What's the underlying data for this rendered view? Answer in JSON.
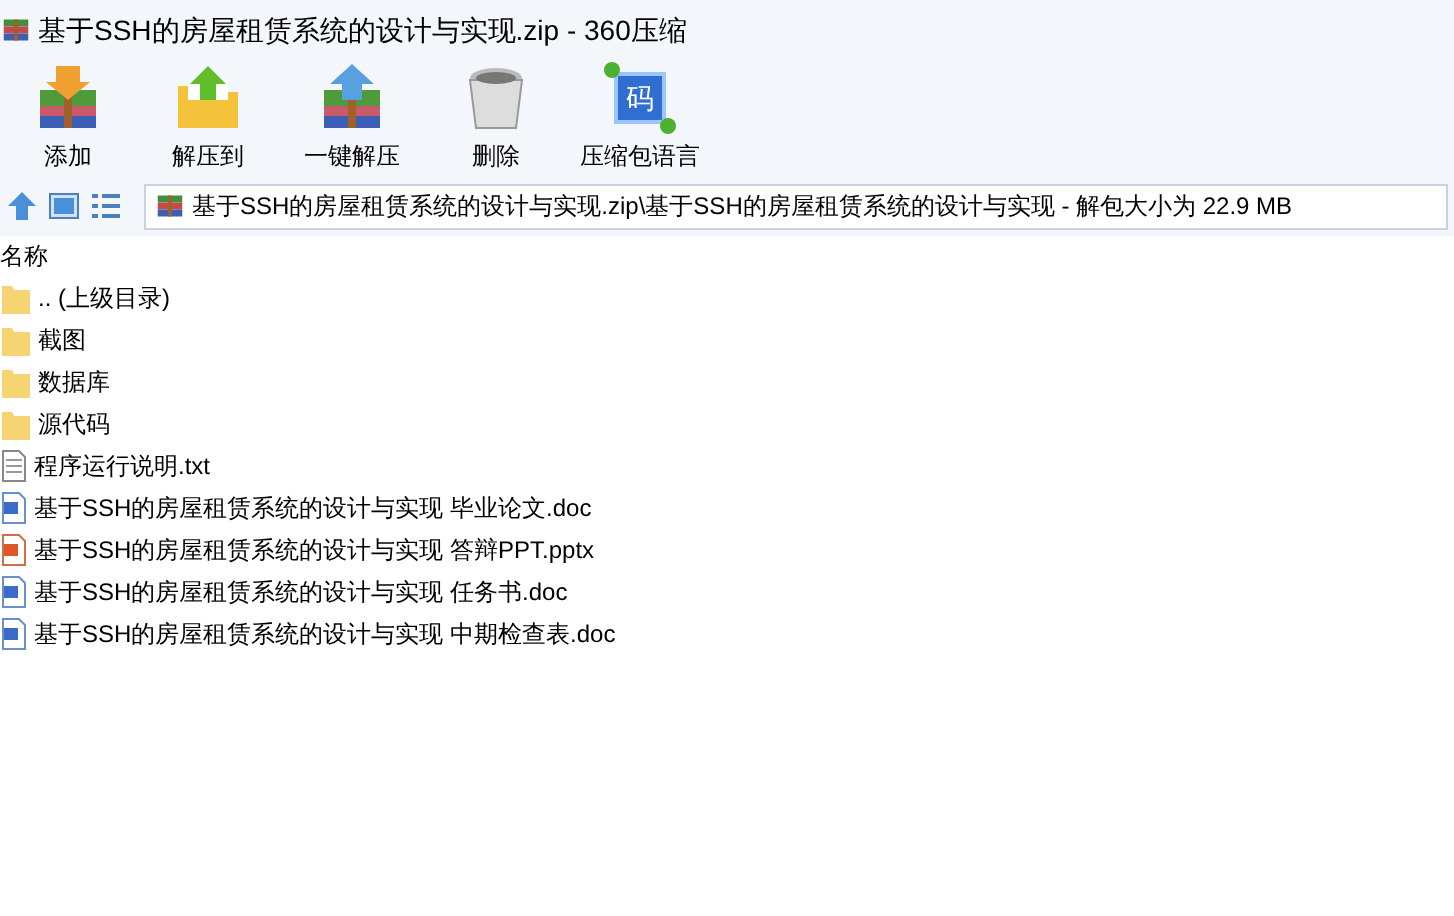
{
  "window": {
    "title": "基于SSH的房屋租赁系统的设计与实现.zip - 360压缩"
  },
  "toolbar": [
    {
      "label": "添加",
      "kind": "add"
    },
    {
      "label": "解压到",
      "kind": "extract"
    },
    {
      "label": "一键解压",
      "kind": "oneclick"
    },
    {
      "label": "删除",
      "kind": "delete"
    },
    {
      "label": "压缩包语言",
      "kind": "lang"
    }
  ],
  "toolbar_icon_text": "码",
  "address": {
    "value": "基于SSH的房屋租赁系统的设计与实现.zip\\基于SSH的房屋租赁系统的设计与实现 - 解包大小为 22.9 MB"
  },
  "table": {
    "columns": [
      "名称"
    ],
    "rows": [
      {
        "name": ".. (上级目录)",
        "kind": "folder"
      },
      {
        "name": "截图",
        "kind": "folder"
      },
      {
        "name": "数据库",
        "kind": "folder"
      },
      {
        "name": "源代码",
        "kind": "folder"
      },
      {
        "name": "程序运行说明.txt",
        "kind": "txt"
      },
      {
        "name": "基于SSH的房屋租赁系统的设计与实现 毕业论文.doc",
        "kind": "doc"
      },
      {
        "name": "基于SSH的房屋租赁系统的设计与实现 答辩PPT.pptx",
        "kind": "ppt"
      },
      {
        "name": "基于SSH的房屋租赁系统的设计与实现 任务书.doc",
        "kind": "doc"
      },
      {
        "name": "基于SSH的房屋租赁系统的设计与实现 中期检查表.doc",
        "kind": "doc"
      }
    ]
  }
}
